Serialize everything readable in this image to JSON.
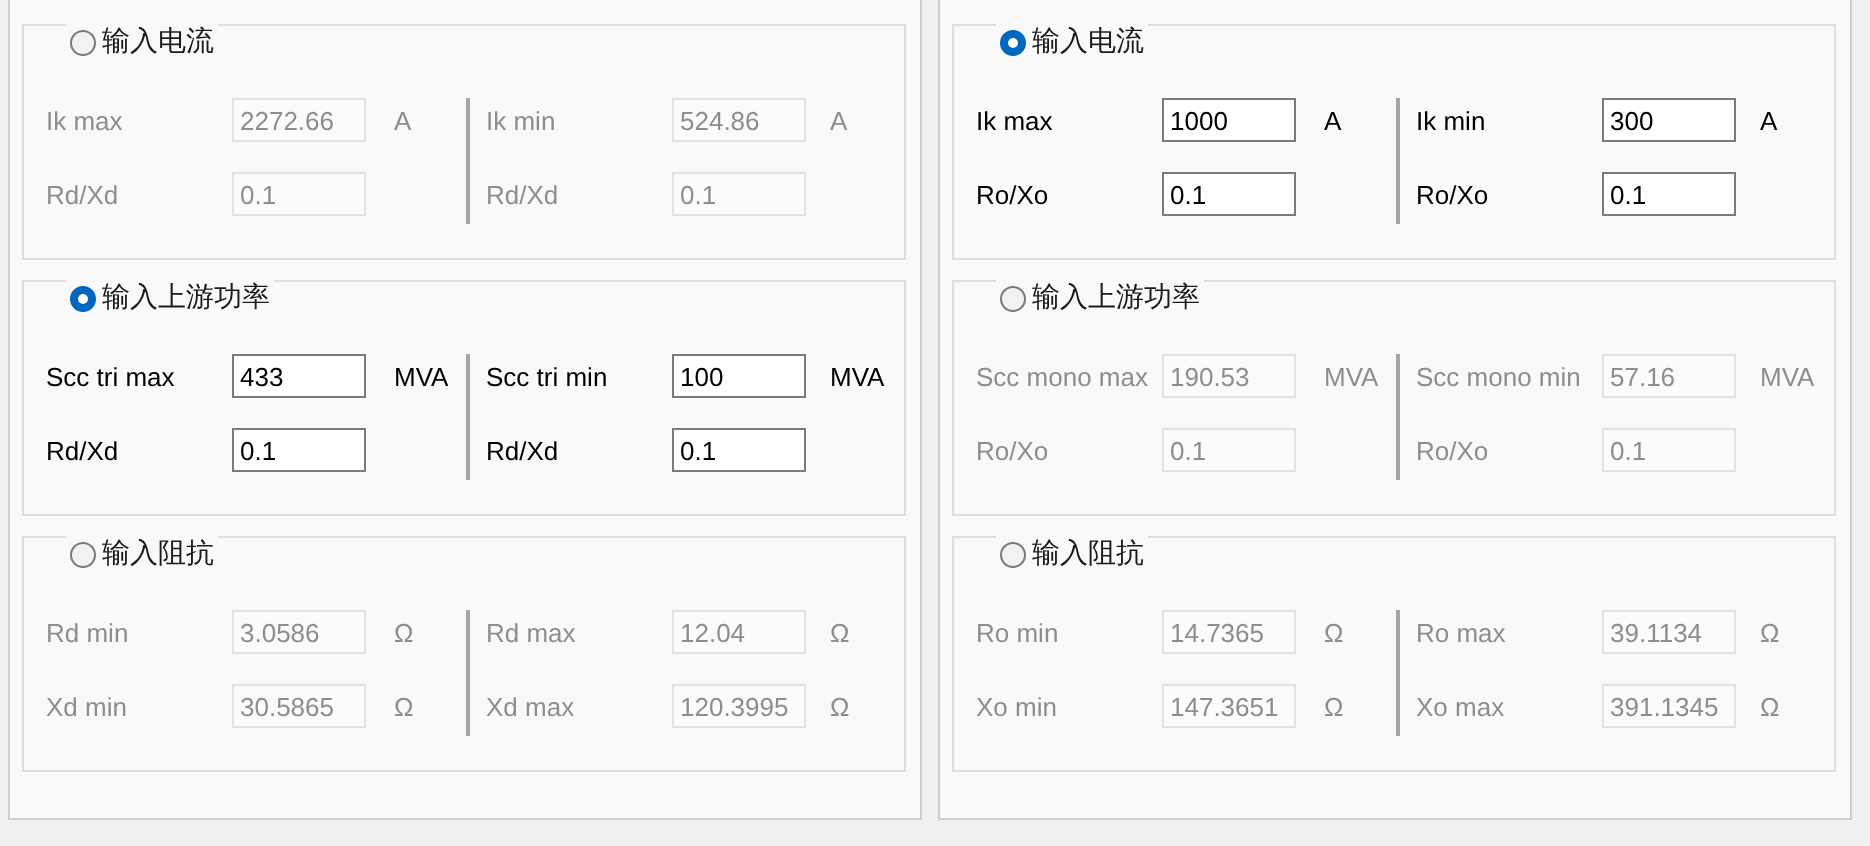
{
  "panels": [
    {
      "sections": [
        {
          "label": "输入电流",
          "selected": false,
          "fields": [
            {
              "label": "Ik max",
              "value": "2272.66",
              "unit": "A"
            },
            {
              "label": "Ik min",
              "value": "524.86",
              "unit": "A"
            },
            {
              "label": "Rd/Xd",
              "value": "0.1"
            },
            {
              "label": "Rd/Xd",
              "value": "0.1"
            }
          ]
        },
        {
          "label": "输入上游功率",
          "selected": true,
          "fields": [
            {
              "label": "Scc tri max",
              "value": "433",
              "unit": "MVA"
            },
            {
              "label": "Scc tri min",
              "value": "100",
              "unit": "MVA"
            },
            {
              "label": "Rd/Xd",
              "value": "0.1"
            },
            {
              "label": "Rd/Xd",
              "value": "0.1"
            }
          ]
        },
        {
          "label": "输入阻抗",
          "selected": false,
          "fields": [
            {
              "label": "Rd min",
              "value": "3.0586",
              "unit": "Ω"
            },
            {
              "label": "Rd max",
              "value": "12.04",
              "unit": "Ω"
            },
            {
              "label": "Xd min",
              "value": "30.5865",
              "unit": "Ω"
            },
            {
              "label": "Xd max",
              "value": "120.3995",
              "unit": "Ω"
            }
          ]
        }
      ]
    },
    {
      "sections": [
        {
          "label": "输入电流",
          "selected": true,
          "fields": [
            {
              "label": "Ik max",
              "value": "1000",
              "unit": "A"
            },
            {
              "label": "Ik min",
              "value": "300",
              "unit": "A"
            },
            {
              "label": "Ro/Xo",
              "value": "0.1"
            },
            {
              "label": "Ro/Xo",
              "value": "0.1"
            }
          ]
        },
        {
          "label": "输入上游功率",
          "selected": false,
          "fields": [
            {
              "label": "Scc mono max",
              "value": "190.53",
              "unit": "MVA"
            },
            {
              "label": "Scc mono min",
              "value": "57.16",
              "unit": "MVA"
            },
            {
              "label": "Ro/Xo",
              "value": "0.1"
            },
            {
              "label": "Ro/Xo",
              "value": "0.1"
            }
          ]
        },
        {
          "label": "输入阻抗",
          "selected": false,
          "fields": [
            {
              "label": "Ro min",
              "value": "14.7365",
              "unit": "Ω"
            },
            {
              "label": "Ro max",
              "value": "39.1134",
              "unit": "Ω"
            },
            {
              "label": "Xo min",
              "value": "147.3651",
              "unit": "Ω"
            },
            {
              "label": "Xo max",
              "value": "391.1345",
              "unit": "Ω"
            }
          ]
        }
      ]
    }
  ]
}
